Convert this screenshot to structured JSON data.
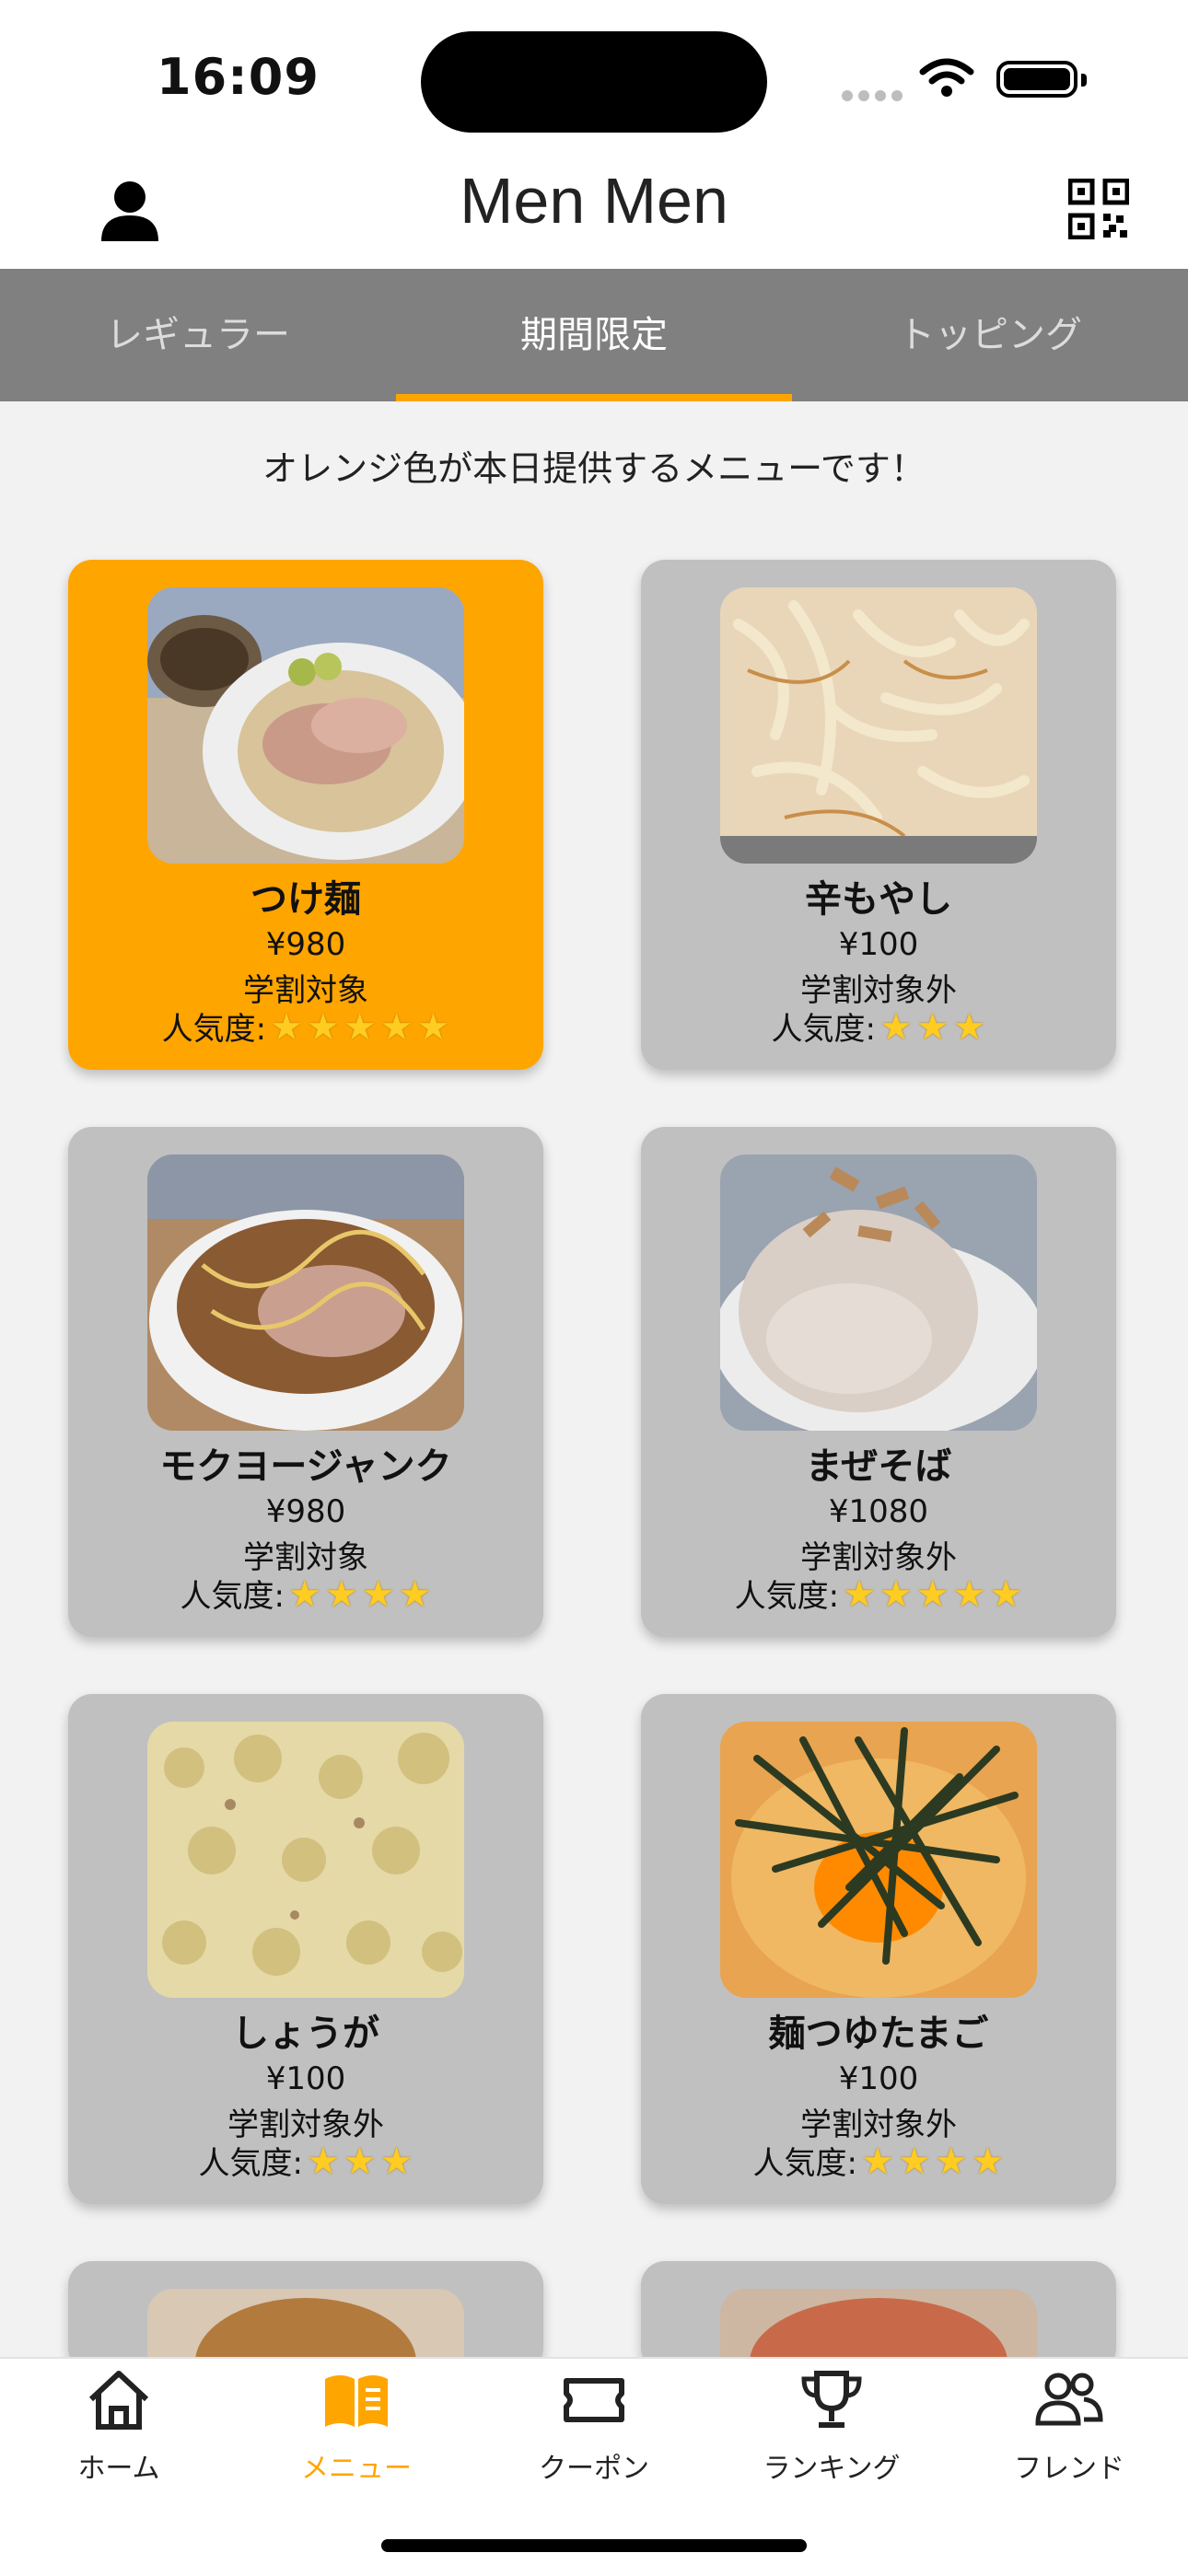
{
  "status": {
    "time": "16:09"
  },
  "header": {
    "title": "Men Men",
    "left_icon": "user-icon",
    "right_icon": "qr-code-icon"
  },
  "tabs": [
    {
      "label": "レギュラー",
      "active": false
    },
    {
      "label": "期間限定",
      "active": true
    },
    {
      "label": "トッピング",
      "active": false
    }
  ],
  "subtitle": "オレンジ色が本日提供するメニューです！",
  "popularity_label": "人気度:",
  "menu": [
    {
      "name": "つけ麺",
      "price": "¥980",
      "discount": "学割対象",
      "stars": 5,
      "highlight": true,
      "photo": "tsukemen-photo"
    },
    {
      "name": "辛もやし",
      "price": "¥100",
      "discount": "学割対象外",
      "stars": 3,
      "highlight": false,
      "photo": "moyashi-photo"
    },
    {
      "name": "モクヨージャンク",
      "price": "¥980",
      "discount": "学割対象",
      "stars": 4,
      "highlight": false,
      "photo": "junk-noodle-photo"
    },
    {
      "name": "まぜそば",
      "price": "¥1080",
      "discount": "学割対象外",
      "stars": 5,
      "highlight": false,
      "photo": "mazesoba-photo"
    },
    {
      "name": "しょうが",
      "price": "¥100",
      "discount": "学割対象外",
      "stars": 3,
      "highlight": false,
      "photo": "ginger-photo"
    },
    {
      "name": "麺つゆたまご",
      "price": "¥100",
      "discount": "学割対象外",
      "stars": 4,
      "highlight": false,
      "photo": "egg-photo"
    }
  ],
  "colors": {
    "accent": "#ffa500",
    "tab_bar": "#808080",
    "card": "#c0c0c0"
  },
  "bottom_nav": [
    {
      "label": "ホーム",
      "icon": "home-icon",
      "active": false
    },
    {
      "label": "メニュー",
      "icon": "menu-book-icon",
      "active": true
    },
    {
      "label": "クーポン",
      "icon": "ticket-icon",
      "active": false
    },
    {
      "label": "ランキング",
      "icon": "trophy-icon",
      "active": false
    },
    {
      "label": "フレンド",
      "icon": "friends-icon",
      "active": false
    }
  ]
}
